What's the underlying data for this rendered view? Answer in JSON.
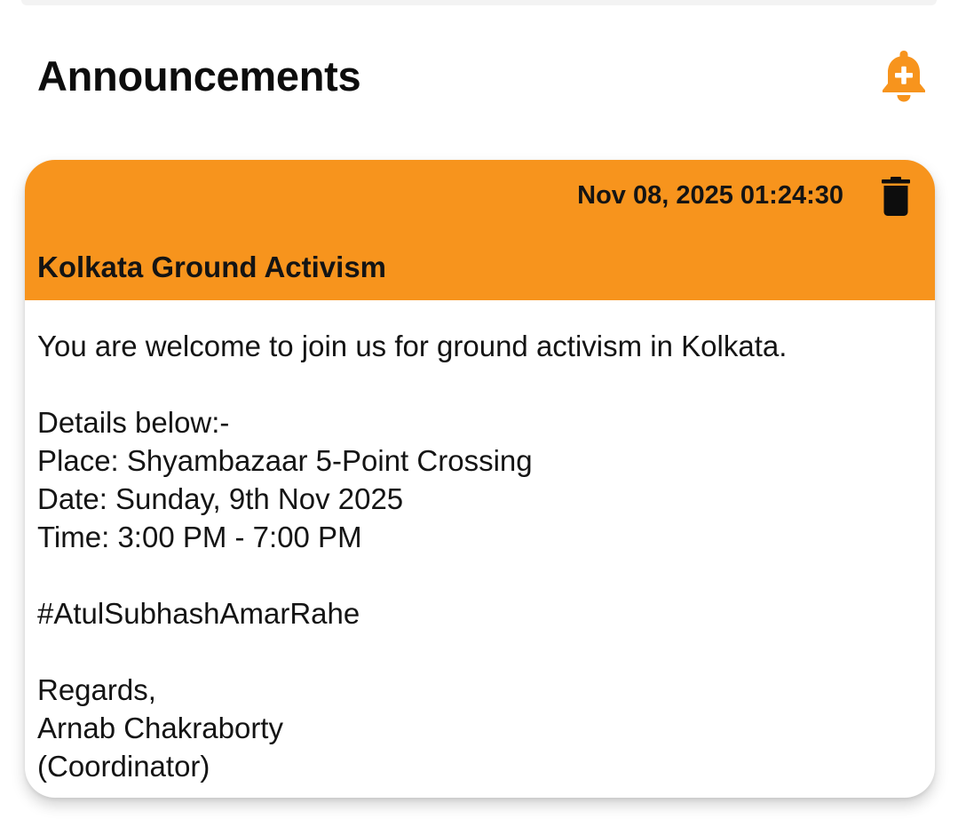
{
  "page": {
    "title": "Announcements",
    "add_icon": "bell-plus-icon"
  },
  "colors": {
    "accent": "#F7941D",
    "card_background": "#FFFFFF",
    "text": "#141414"
  },
  "announcement": {
    "timestamp": "Nov 08, 2025 01:24:30",
    "delete_icon": "trash-icon",
    "title": "Kolkata Ground Activism",
    "body": "You are welcome to join us for ground activism in Kolkata.\n\nDetails below:-\nPlace: Shyambazaar 5-Point Crossing\nDate: Sunday, 9th Nov 2025\nTime: 3:00 PM - 7:00 PM\n\n#AtulSubhashAmarRahe\n\nRegards,\nArnab Chakraborty\n(Coordinator)"
  }
}
